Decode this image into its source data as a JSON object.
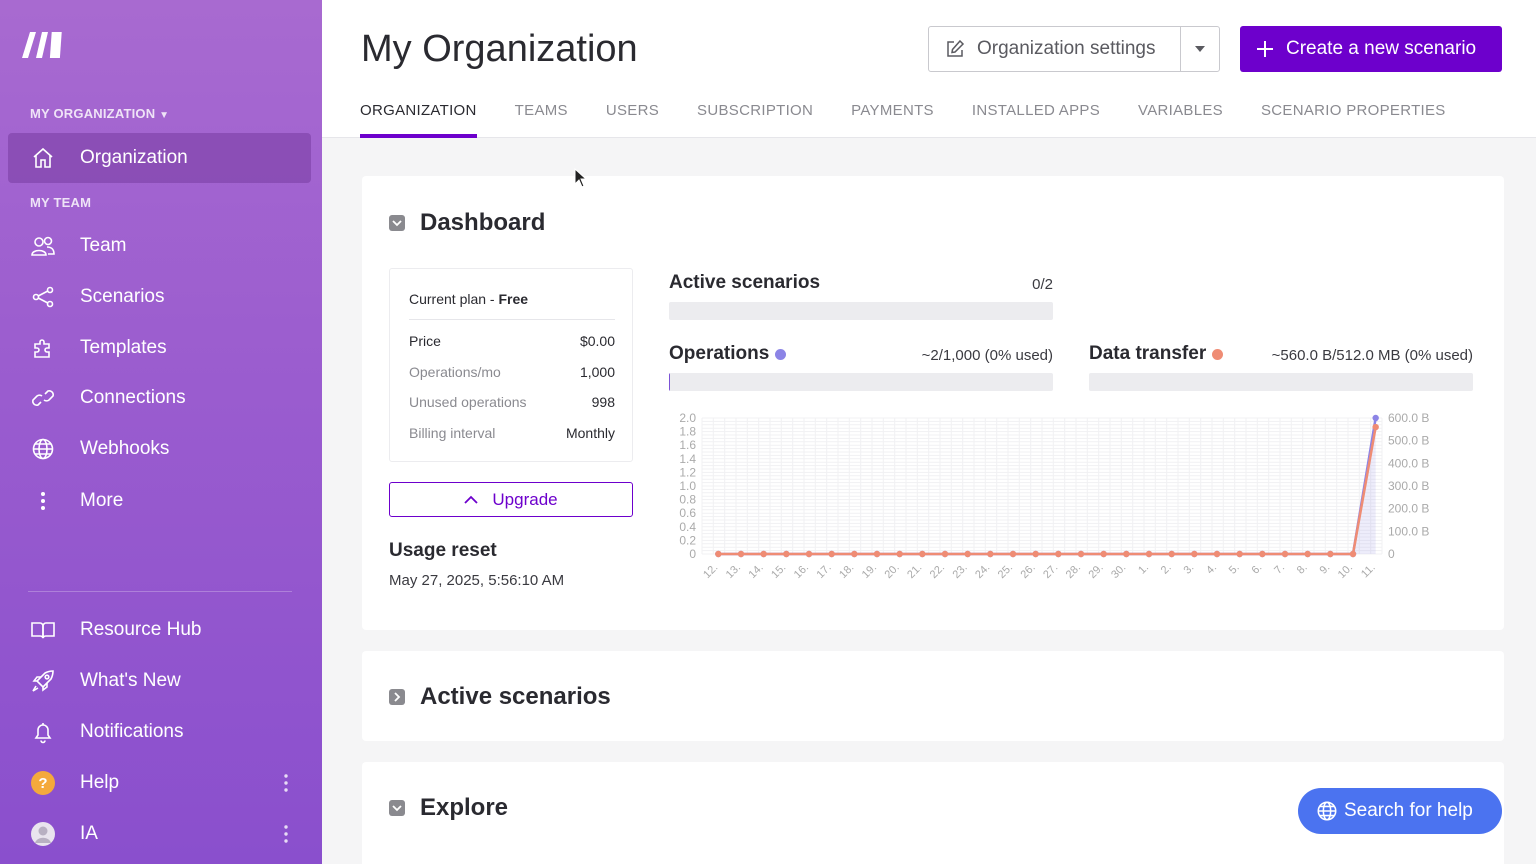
{
  "sidebar": {
    "org_section": "MY ORGANIZATION",
    "team_section": "MY TEAM",
    "org_items": [
      {
        "label": "Organization",
        "icon": "home-icon"
      }
    ],
    "team_items": [
      {
        "label": "Team",
        "icon": "team-icon"
      },
      {
        "label": "Scenarios",
        "icon": "share-icon"
      },
      {
        "label": "Templates",
        "icon": "puzzle-icon"
      },
      {
        "label": "Connections",
        "icon": "link-icon"
      },
      {
        "label": "Webhooks",
        "icon": "globe-icon"
      },
      {
        "label": "More",
        "icon": "more-vertical-icon"
      }
    ],
    "bottom_items": [
      {
        "label": "Resource Hub",
        "icon": "book-icon"
      },
      {
        "label": "What's New",
        "icon": "rocket-icon"
      },
      {
        "label": "Notifications",
        "icon": "bell-icon"
      },
      {
        "label": "Help",
        "icon": "help-icon"
      },
      {
        "label": "IA",
        "icon": "avatar"
      }
    ]
  },
  "header": {
    "title": "My Organization",
    "settings_label": "Organization settings",
    "create_label": "Create a new scenario",
    "tabs": [
      "ORGANIZATION",
      "TEAMS",
      "USERS",
      "SUBSCRIPTION",
      "PAYMENTS",
      "INSTALLED APPS",
      "VARIABLES",
      "SCENARIO PROPERTIES"
    ],
    "active_tab": "ORGANIZATION"
  },
  "dashboard": {
    "title": "Dashboard",
    "plan": {
      "label": "Current plan",
      "name": "Free",
      "rows": [
        {
          "key": "Price",
          "value": "$0.00"
        },
        {
          "key": "Operations/mo",
          "value": "1,000"
        },
        {
          "key": "Unused operations",
          "value": "998"
        },
        {
          "key": "Billing interval",
          "value": "Monthly"
        }
      ]
    },
    "upgrade_label": "Upgrade",
    "usage_reset_label": "Usage reset",
    "usage_reset_date": "May 27, 2025, 5:56:10 AM",
    "active_scenarios": {
      "label": "Active scenarios",
      "value": "0/2",
      "fraction": 0
    },
    "operations": {
      "label": "Operations",
      "value": "~2/1,000 (0% used)",
      "fraction": 0.002
    },
    "data_transfer": {
      "label": "Data transfer",
      "value": "~560.0 B/512.0 MB (0% used)",
      "fraction": 1e-06
    }
  },
  "chart_data": {
    "type": "line",
    "x": [
      "12.",
      "13.",
      "14.",
      "15.",
      "16.",
      "17.",
      "18.",
      "19.",
      "20.",
      "21.",
      "22.",
      "23.",
      "24.",
      "25.",
      "26.",
      "27.",
      "28.",
      "29.",
      "30.",
      "1.",
      "2.",
      "3.",
      "4.",
      "5.",
      "6.",
      "7.",
      "8.",
      "9.",
      "10.",
      "11."
    ],
    "series": [
      {
        "name": "Operations",
        "axis": "left",
        "values": [
          0,
          0,
          0,
          0,
          0,
          0,
          0,
          0,
          0,
          0,
          0,
          0,
          0,
          0,
          0,
          0,
          0,
          0,
          0,
          0,
          0,
          0,
          0,
          0,
          0,
          0,
          0,
          0,
          0,
          2
        ]
      },
      {
        "name": "Data transfer",
        "axis": "right",
        "values": [
          0,
          0,
          0,
          0,
          0,
          0,
          0,
          0,
          0,
          0,
          0,
          0,
          0,
          0,
          0,
          0,
          0,
          0,
          0,
          0,
          0,
          0,
          0,
          0,
          0,
          0,
          0,
          0,
          0,
          560
        ]
      }
    ],
    "y_left_ticks": [
      "0",
      "0.2",
      "0.4",
      "0.6",
      "0.8",
      "1.0",
      "1.2",
      "1.4",
      "1.6",
      "1.8",
      "2.0"
    ],
    "y_right_ticks": [
      "0",
      "100.0 B",
      "200.0 B",
      "300.0 B",
      "400.0 B",
      "500.0 B",
      "600.0 B"
    ],
    "y_left_lim": [
      0,
      2
    ],
    "y_right_lim": [
      0,
      600
    ],
    "colors": {
      "Operations": "#8c84e6",
      "Data transfer": "#ef8c74"
    },
    "grid": true
  },
  "sections": {
    "active_scenarios": "Active scenarios",
    "explore": "Explore"
  },
  "help": {
    "search_label": "Search for help"
  },
  "colors": {
    "brand": "#6d00cc",
    "help": "#4b73f0",
    "operations": "#8c84e6",
    "data_transfer": "#ef8c74"
  }
}
